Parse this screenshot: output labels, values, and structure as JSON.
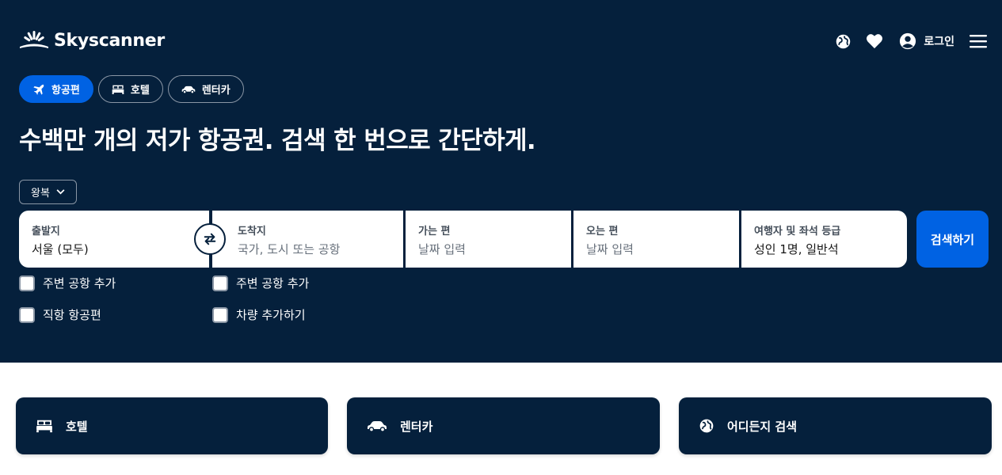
{
  "brand": {
    "name": "Skyscanner"
  },
  "header": {
    "icons": [
      "globe-icon",
      "heart-icon",
      "user-icon",
      "menu-icon"
    ],
    "login_label": "로그인"
  },
  "tabs": [
    {
      "label": "항공편",
      "icon": "plane-icon",
      "active": true
    },
    {
      "label": "호텔",
      "icon": "bed-icon",
      "active": false
    },
    {
      "label": "렌터카",
      "icon": "car-icon",
      "active": false
    }
  ],
  "headline": "수백만 개의 저가 항공권. 검색 한 번으로 간단하게.",
  "trip_type": {
    "selected": "왕복"
  },
  "search": {
    "origin": {
      "label": "출발지",
      "value": "서울 (모두)"
    },
    "destination": {
      "label": "도착지",
      "placeholder": "국가, 도시 또는 공항"
    },
    "depart": {
      "label": "가는 편",
      "placeholder": "날짜 입력"
    },
    "return": {
      "label": "오는 편",
      "placeholder": "날짜 입력"
    },
    "travellers": {
      "label": "여행자 및 좌석 등급",
      "value": "성인 1명, 일반석"
    },
    "button_label": "검색하기"
  },
  "checkboxes": {
    "origin_nearby": {
      "label": "주변 공항 추가",
      "checked": false
    },
    "direct_flights": {
      "label": "직항 항공편",
      "checked": false
    },
    "dest_nearby": {
      "label": "주변 공항 추가",
      "checked": false
    },
    "add_car": {
      "label": "차량 추가하기",
      "checked": false
    }
  },
  "cards": [
    {
      "label": "호텔",
      "icon": "bed-icon"
    },
    {
      "label": "렌터카",
      "icon": "car-icon"
    },
    {
      "label": "어디든지 검색",
      "icon": "globe-icon"
    }
  ],
  "colors": {
    "hero_bg": "#05203c",
    "accent": "#0062e3",
    "white": "#ffffff"
  }
}
